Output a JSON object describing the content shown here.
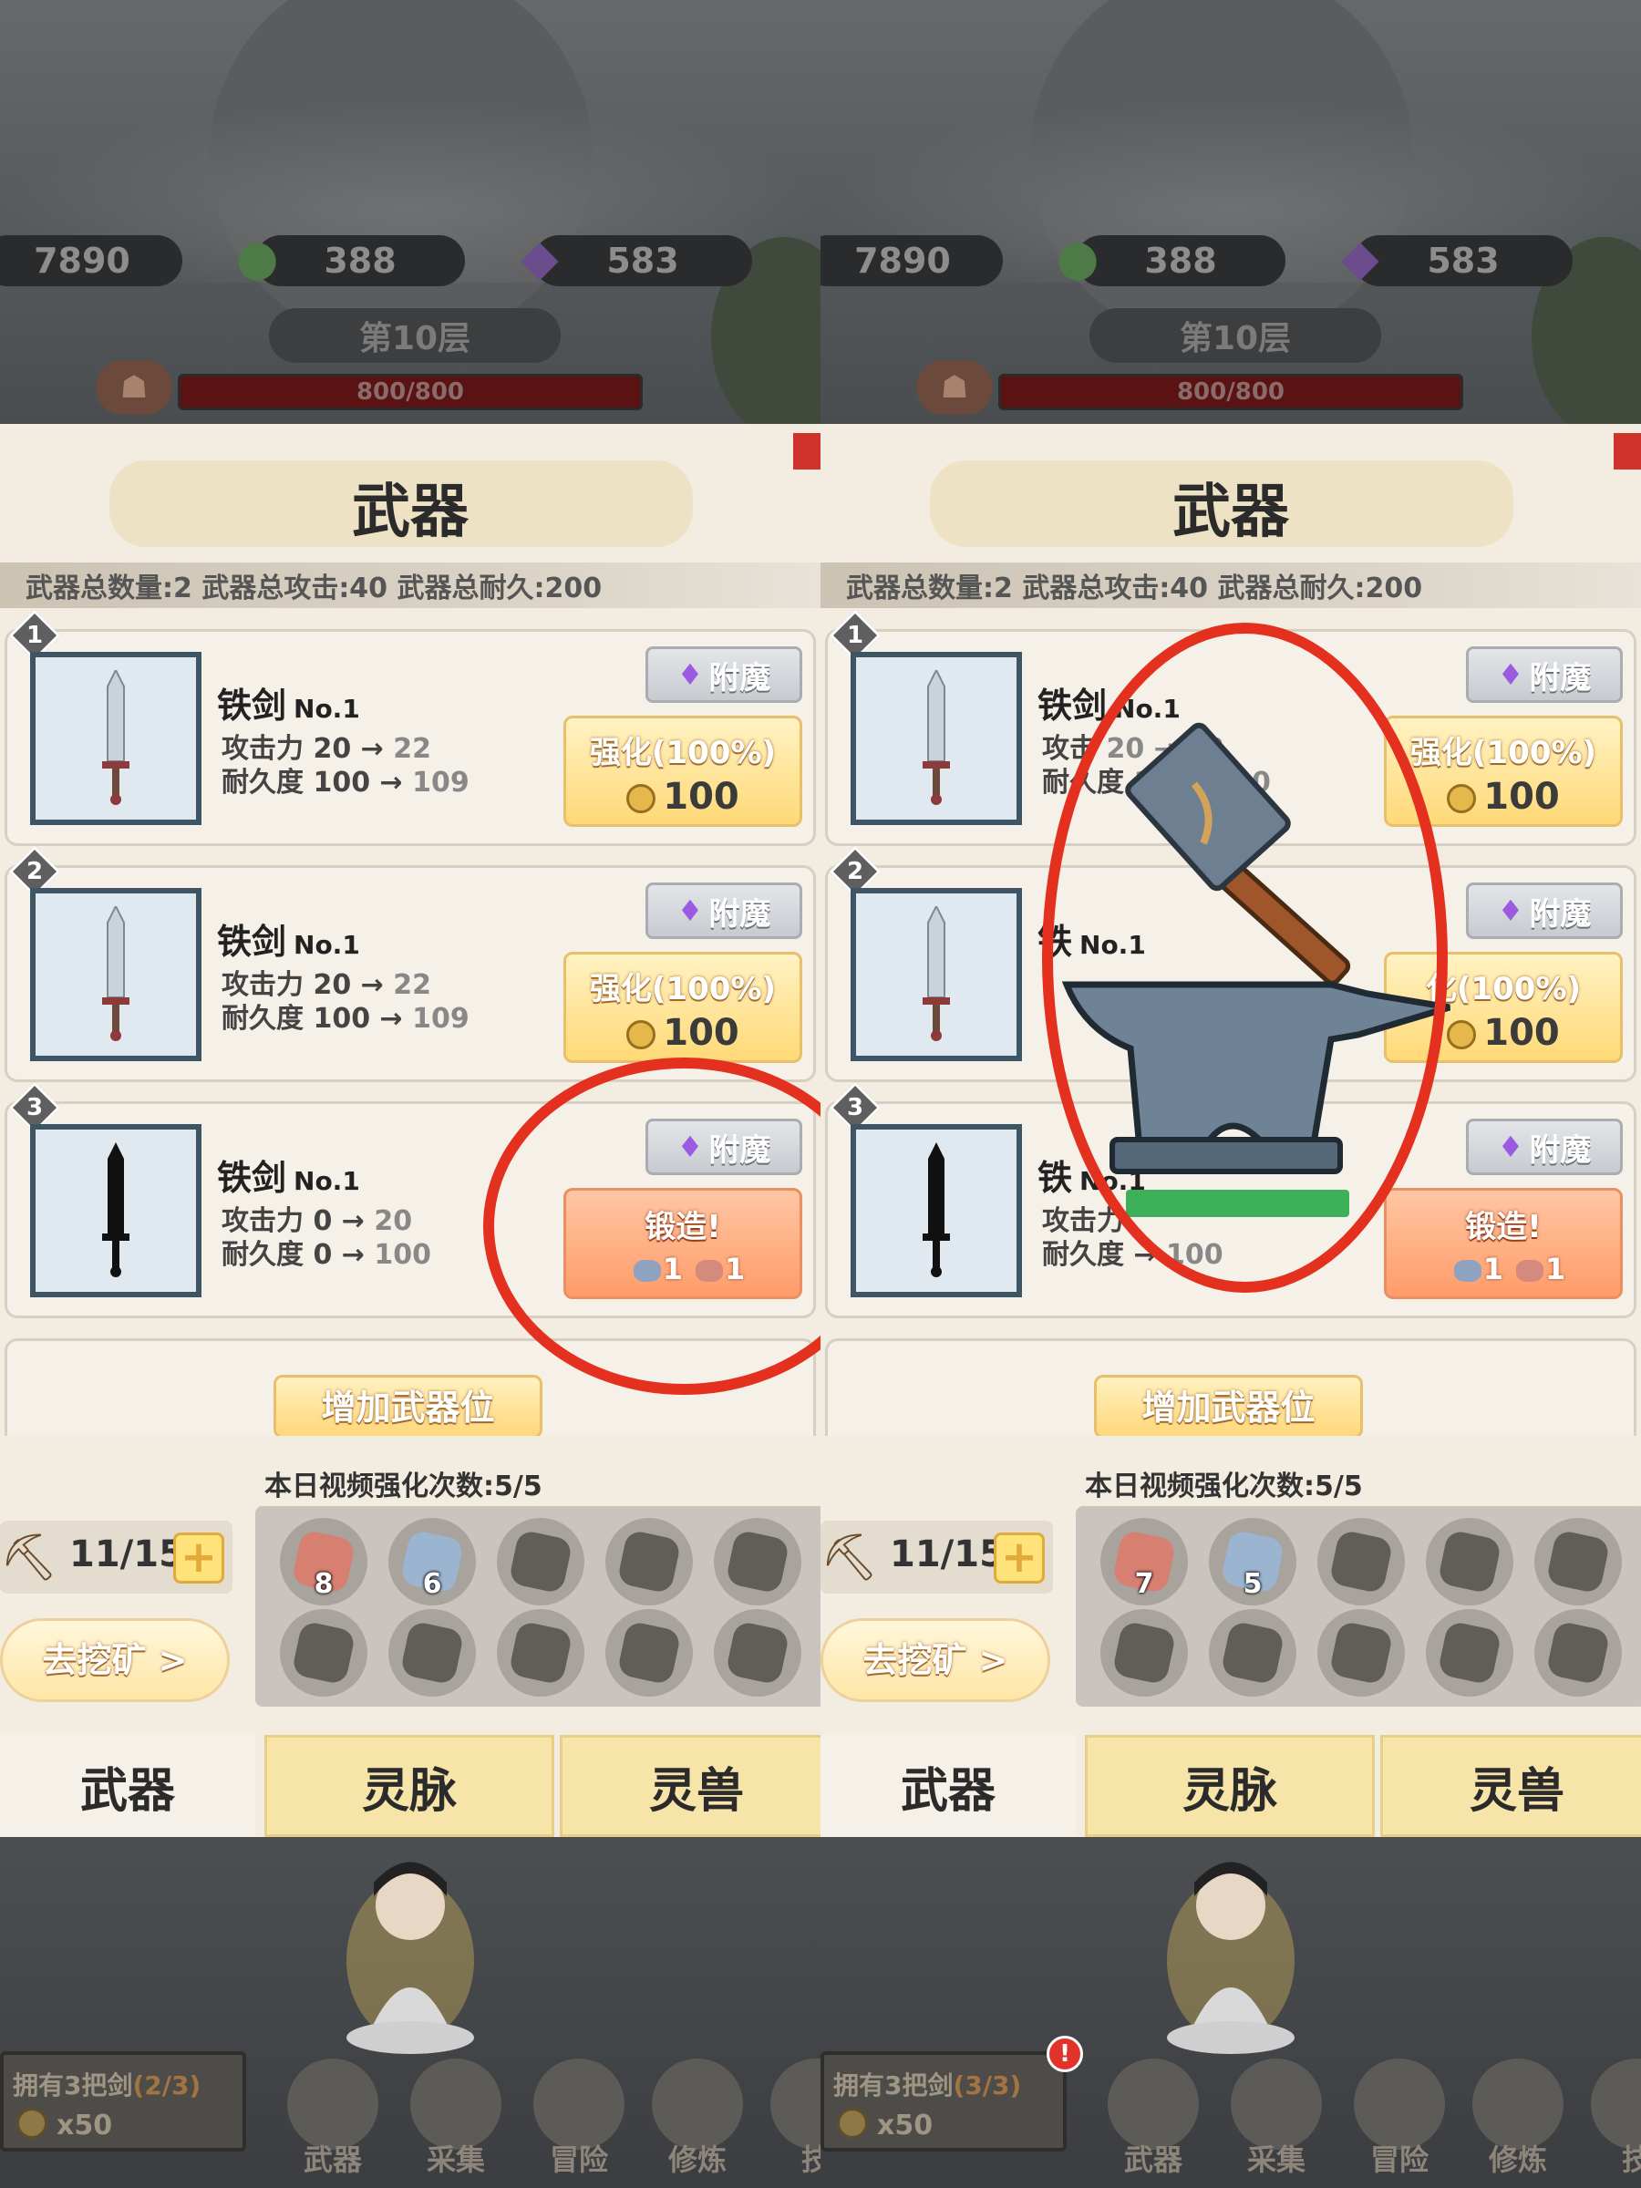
{
  "panels": [
    {
      "resources": {
        "gold": "7890",
        "green": "388",
        "purple": "583"
      },
      "floor": "第10层",
      "hp": "800/800",
      "weapon_panel": {
        "title": "武器",
        "stats": "武器总数量:2  武器总攻击:40  武器总耐久:200",
        "cards": [
          {
            "num": "1",
            "name": "铁剑",
            "tag": "No.1",
            "atk": "攻击力 20",
            "atk_to": "22",
            "dur": "耐久度 100",
            "dur_to": "109",
            "enchant": "附魔",
            "upgrade": "强化(100%)",
            "cost": "100"
          },
          {
            "num": "2",
            "name": "铁剑",
            "tag": "No.1",
            "atk": "攻击力 20",
            "atk_to": "22",
            "dur": "耐久度 100",
            "dur_to": "109",
            "enchant": "附魔",
            "upgrade": "强化(100%)",
            "cost": "100"
          },
          {
            "num": "3",
            "name": "铁剑",
            "tag": "No.1",
            "atk": "攻击力 0",
            "atk_to": "20",
            "dur": "耐久度 0",
            "dur_to": "100",
            "enchant": "附魔",
            "forge": "锻造!",
            "ore_blue": "1",
            "ore_red": "1"
          }
        ],
        "add_slot": "增加武器位"
      },
      "video_text": "本日视频强化次数:5/5",
      "pick_count": "11/15",
      "mine_button": "去挖矿 >",
      "ores": {
        "red": "8",
        "blue": "6"
      },
      "tabs": [
        "武器",
        "灵脉",
        "灵兽"
      ],
      "sword_box": {
        "owned": "拥有3把剑",
        "progress": "(2/3)",
        "cost": "x50"
      },
      "nav": [
        "武器",
        "采集",
        "冒险",
        "修炼",
        "技"
      ]
    },
    {
      "resources": {
        "gold": "7890",
        "green": "388",
        "purple": "583"
      },
      "floor": "第10层",
      "hp": "800/800",
      "weapon_panel": {
        "title": "武器",
        "stats": "武器总数量:2  武器总攻击:40  武器总耐久:200",
        "cards": [
          {
            "num": "1",
            "name": "铁剑",
            "tag": "No.1",
            "atk": "攻击",
            "atk_to": "20 → 22",
            "dur": "耐久度",
            "dur_to": "100 → 10",
            "enchant": "附魔",
            "upgrade": "强化(100%)",
            "cost": "100"
          },
          {
            "num": "2",
            "name": "铁",
            "tag": "No.1",
            "atk": "",
            "atk_to": "",
            "dur": "",
            "dur_to": "",
            "enchant": "附魔",
            "upgrade": "化(100%)",
            "cost": "100"
          },
          {
            "num": "3",
            "name": "铁",
            "tag": "No.1",
            "atk": "攻击力",
            "atk_to": "",
            "dur": "耐久度",
            "dur_to": "100",
            "enchant": "附魔",
            "forge": "锻造!",
            "ore_blue": "1",
            "ore_red": "1"
          }
        ],
        "add_slot": "增加武器位"
      },
      "video_text": "本日视频强化次数:5/5",
      "pick_count": "11/15",
      "mine_button": "去挖矿 >",
      "ores": {
        "red": "7",
        "blue": "5"
      },
      "tabs": [
        "武器",
        "灵脉",
        "灵兽"
      ],
      "sword_box": {
        "owned": "拥有3把剑",
        "progress": "(3/3)",
        "cost": "x50"
      },
      "nav": [
        "武器",
        "采集",
        "冒险",
        "修炼",
        "技"
      ],
      "badge": "!"
    }
  ],
  "colors": {
    "accent_red": "#e3301f",
    "upgrade_yellow": "#ffd977",
    "forge_orange": "#ff9c6a",
    "progress_green": "#3fb05a"
  },
  "icons": [
    "coin-icon",
    "green-gourd-icon",
    "purple-crystal-icon",
    "demon-mask-icon",
    "pickaxe-icon",
    "hammer-icon",
    "anvil-icon",
    "sword-icon",
    "ore-icon"
  ]
}
